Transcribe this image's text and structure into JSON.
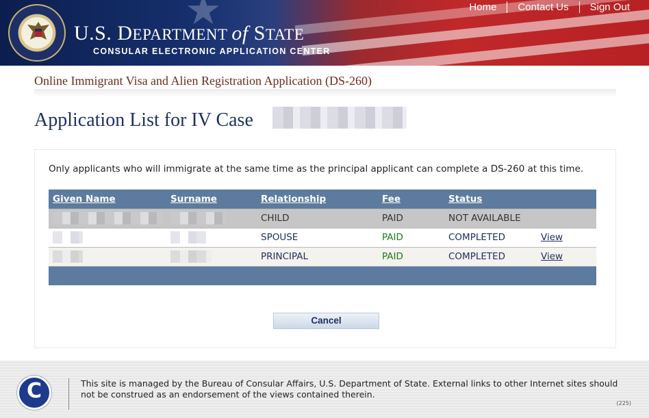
{
  "header": {
    "dept_title_a": "U.S. D",
    "dept_title_b": "EPARTMENT ",
    "dept_title_of": "of",
    "dept_title_c": " S",
    "dept_title_d": "TATE",
    "subtitle": "CONSULAR ELECTRONIC APPLICATION CENTER",
    "nav": [
      "Home",
      "Contact Us",
      "Sign Out"
    ]
  },
  "form_title": "Online Immigrant Visa and Alien Registration Application (DS-260)",
  "page_title": "Application List for IV Case",
  "note": "Only applicants who will immigrate at the same time as the principal applicant can complete a DS-260 at this time.",
  "table": {
    "headers": [
      "Given Name",
      "Surname",
      "Relationship",
      "Fee",
      "Status"
    ],
    "rows": [
      {
        "relationship": "CHILD",
        "fee": "PAID",
        "status": "NOT AVAILABLE",
        "action": ""
      },
      {
        "relationship": "SPOUSE",
        "fee": "PAID",
        "status": "COMPLETED",
        "action": "View"
      },
      {
        "relationship": "PRINCIPAL",
        "fee": "PAID",
        "status": "COMPLETED",
        "action": "View"
      }
    ]
  },
  "cancel_label": "Cancel",
  "footer": {
    "text": "This site is managed by the Bureau of Consular Affairs, U.S. Department of State. External links to other Internet sites should not be construed as an endorsement of the views contained therein.",
    "code": "(225)"
  },
  "colors": {
    "header_navy": "#16306e",
    "header_red": "#c0282a",
    "table_header": "#5d7b9e",
    "paid_green": "#1c7a1c",
    "title_navy": "#1f3060"
  }
}
